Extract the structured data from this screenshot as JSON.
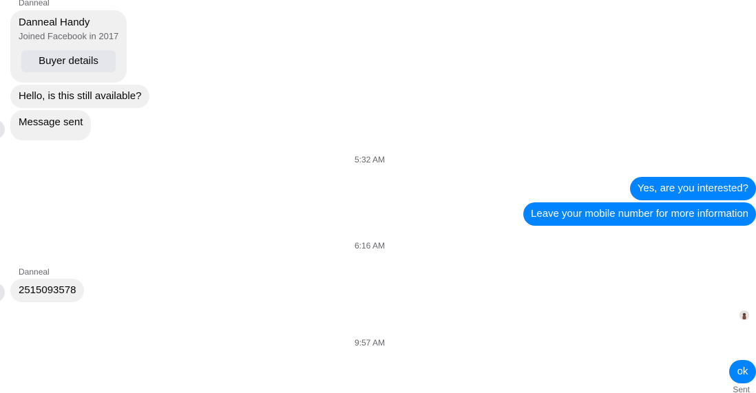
{
  "thread": {
    "incoming_sender_top": "Danneal",
    "card": {
      "name": "Danneal Handy",
      "subtitle": "Joined Facebook in 2017",
      "button_label": "Buyer details"
    },
    "msg_available": "Hello, is this still available?",
    "msg_sent_notice": "Message sent",
    "timestamp_1": "5:32 AM",
    "out_msg_1": "Yes, are you interested?",
    "out_msg_2": "Leave your mobile number for more information",
    "timestamp_2": "6:16 AM",
    "incoming_sender_2": "Danneal",
    "msg_number": "2515093578",
    "timestamp_3": "9:57 AM",
    "out_msg_3": "ok",
    "status_sent": "Sent"
  },
  "colors": {
    "outgoing_bubble": "#0084ff",
    "incoming_bubble": "#f0f0f0",
    "secondary_text": "#65676b"
  }
}
